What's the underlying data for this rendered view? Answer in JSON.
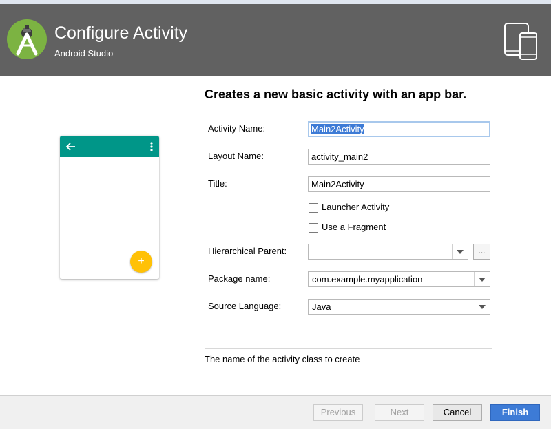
{
  "header": {
    "title": "Configure Activity",
    "subtitle": "Android Studio",
    "logo_icon": "android-studio-logo-icon",
    "device_icon": "tablet-phone-icon"
  },
  "colors": {
    "header_bg": "#616161",
    "logo_green": "#7cb342",
    "appbar_teal": "#009688",
    "fab_amber": "#ffc107",
    "accent_blue": "#3d7bd6",
    "focus_border": "#a8c8ec"
  },
  "content": {
    "title": "Creates a new basic activity with an app bar."
  },
  "preview": {
    "back_icon": "arrow-back-icon",
    "menu_icon": "more-vert-icon",
    "fab_icon": "plus-icon",
    "fab_glyph": "+"
  },
  "form": {
    "activity_name": {
      "label": "Activity Name:",
      "value": "Main2Activity"
    },
    "layout_name": {
      "label": "Layout Name:",
      "value": "activity_main2"
    },
    "title": {
      "label": "Title:",
      "value": "Main2Activity"
    },
    "launcher_activity": {
      "label": "Launcher Activity",
      "checked": false
    },
    "use_fragment": {
      "label": "Use a Fragment",
      "checked": false
    },
    "hierarchical_parent": {
      "label": "Hierarchical Parent:",
      "value": "",
      "browse_label": "..."
    },
    "package_name": {
      "label": "Package name:",
      "value": "com.example.myapplication"
    },
    "source_language": {
      "label": "Source Language:",
      "value": "Java"
    }
  },
  "help_text": "The name of the activity class to create",
  "footer": {
    "previous_label": "Previous",
    "next_label": "Next",
    "cancel_label": "Cancel",
    "finish_label": "Finish"
  }
}
